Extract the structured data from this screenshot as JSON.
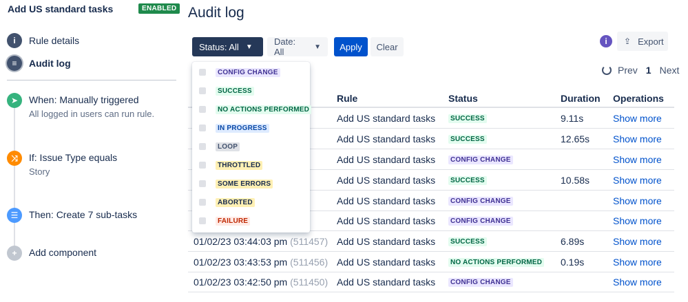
{
  "sidebar": {
    "rule_title": "Add US standard tasks",
    "enabled_badge": "ENABLED",
    "nav": [
      {
        "label": "Rule details",
        "icon": "info-icon"
      },
      {
        "label": "Audit log",
        "icon": "document-icon"
      }
    ],
    "components": [
      {
        "title": "When: Manually triggered",
        "subtitle": "All logged in users can run rule.",
        "icon": "pointer-icon",
        "color": "#36b37e"
      },
      {
        "title": "If: Issue Type equals",
        "subtitle": "Story",
        "icon": "shuffle-icon",
        "color": "#ff8b00"
      },
      {
        "title": "Then: Create 7 sub-tasks",
        "subtitle": "",
        "icon": "list-icon",
        "color": "#4c9aff"
      },
      {
        "title": "Add component",
        "subtitle": "",
        "icon": "plus-icon",
        "color": "#c1c7d0"
      }
    ]
  },
  "main": {
    "title": "Audit log",
    "filters": {
      "status_label": "Status: All",
      "date_label": "Date: All",
      "apply_label": "Apply",
      "clear_label": "Clear"
    },
    "export_label": "Export",
    "pager": {
      "prev": "Prev",
      "page": "1",
      "next": "Next"
    },
    "table": {
      "headers": [
        "Rule",
        "Status",
        "Duration",
        "Operations"
      ],
      "rows": [
        {
          "date": "",
          "id": "",
          "rule": "Add US standard tasks",
          "status": "SUCCESS",
          "duration": "9.11s",
          "op": "Show more"
        },
        {
          "date": "",
          "id": "",
          "rule": "Add US standard tasks",
          "status": "SUCCESS",
          "duration": "12.65s",
          "op": "Show more"
        },
        {
          "date": "",
          "id": "",
          "rule": "Add US standard tasks",
          "status": "CONFIG CHANGE",
          "duration": "",
          "op": "Show more"
        },
        {
          "date": "",
          "id": "",
          "rule": "Add US standard tasks",
          "status": "SUCCESS",
          "duration": "10.58s",
          "op": "Show more"
        },
        {
          "date": "",
          "id": "",
          "rule": "Add US standard tasks",
          "status": "CONFIG CHANGE",
          "duration": "",
          "op": "Show more"
        },
        {
          "date": "",
          "id": "",
          "rule": "Add US standard tasks",
          "status": "CONFIG CHANGE",
          "duration": "",
          "op": "Show more"
        },
        {
          "date": "01/02/23 03:44:03 pm",
          "id": "(511457)",
          "rule": "Add US standard tasks",
          "status": "SUCCESS",
          "duration": "6.89s",
          "op": "Show more"
        },
        {
          "date": "01/02/23 03:43:53 pm",
          "id": "(511456)",
          "rule": "Add US standard tasks",
          "status": "NO ACTIONS PERFORMED",
          "duration": "0.19s",
          "op": "Show more"
        },
        {
          "date": "01/02/23 03:42:50 pm",
          "id": "(511450)",
          "rule": "Add US standard tasks",
          "status": "CONFIG CHANGE",
          "duration": "",
          "op": "Show more"
        }
      ]
    },
    "status_dropdown": {
      "options": [
        "CONFIG CHANGE",
        "SUCCESS",
        "NO ACTIONS PERFORMED",
        "IN PROGRESS",
        "LOOP",
        "THROTTLED",
        "SOME ERRORS",
        "ABORTED",
        "FAILURE"
      ]
    }
  },
  "colors": {
    "primary": "#0052cc",
    "dark_button": "#253858",
    "enabled": "#1f8a4c"
  }
}
